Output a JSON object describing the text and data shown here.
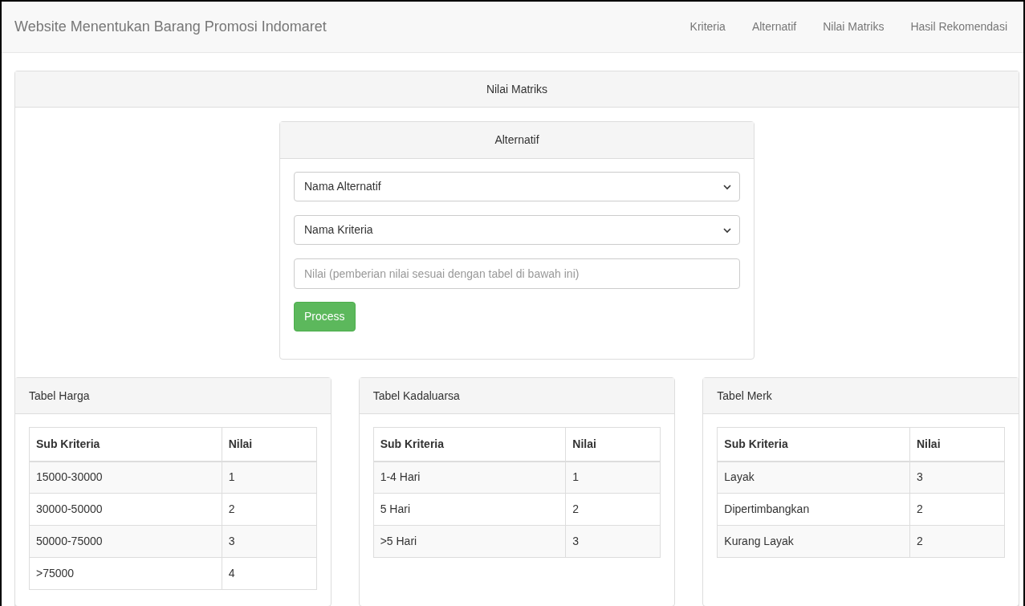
{
  "navbar": {
    "brand": "Website Menentukan Barang Promosi Indomaret",
    "links": [
      {
        "label": "Kriteria",
        "selected": false
      },
      {
        "label": "Alternatif",
        "selected": false
      },
      {
        "label": "Nilai Matriks",
        "selected": false
      },
      {
        "label": "Hasil Rekomendasi",
        "selected": false
      }
    ]
  },
  "panel": {
    "title": "Nilai Matriks"
  },
  "form": {
    "title": "Alternatif",
    "selects": [
      "Nama Alternatif",
      "Nama Kriteria"
    ],
    "input": {
      "placeholder": "Nilai (pemberian nilai sesuai dengan tabel di bawah ini)"
    },
    "button": "Process"
  },
  "tables": [
    {
      "title": "Tabel Harga",
      "columns": [
        "Sub Kriteria",
        "Nilai"
      ],
      "rows": [
        [
          "15000-30000",
          "1"
        ],
        [
          "30000-50000",
          "2"
        ],
        [
          "50000-75000",
          "3"
        ],
        [
          ">75000",
          "4"
        ]
      ]
    },
    {
      "title": "Tabel Kadaluarsa",
      "columns": [
        "Sub Kriteria",
        "Nilai"
      ],
      "rows": [
        [
          "1-4 Hari",
          "1"
        ],
        [
          "5 Hari",
          "2"
        ],
        [
          ">5 Hari",
          "3"
        ]
      ]
    },
    {
      "title": "Tabel Merk",
      "columns": [
        "Sub Kriteria",
        "Nilai"
      ],
      "rows": [
        [
          "Layak",
          "3"
        ],
        [
          "Dipertimbangkan",
          "2"
        ],
        [
          "Kurang Layak",
          "2"
        ]
      ]
    }
  ]
}
